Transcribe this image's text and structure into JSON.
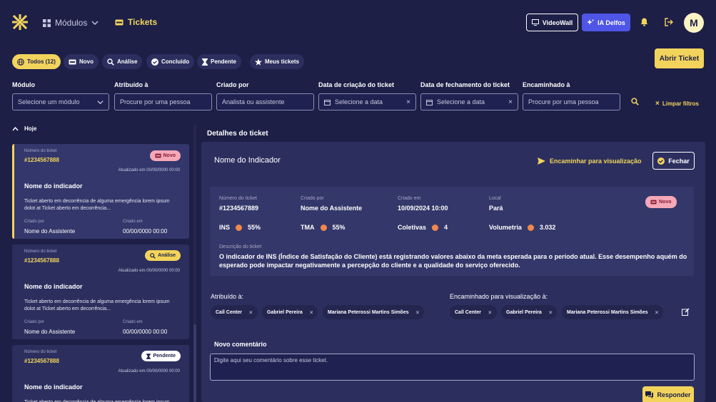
{
  "header": {
    "modulos_label": "Módulos",
    "tickets_label": "Tickets",
    "videowall_label": "VideoWall",
    "ia_label": "IA Delfos",
    "avatar_initial": "M"
  },
  "chips": [
    "Todos (12)",
    "Novo",
    "Análise",
    "Concluído",
    "Pendente",
    "Meus tickets"
  ],
  "abrir_ticket": "Abrir Ticket",
  "filters": {
    "modulo": {
      "label": "Módulo",
      "placeholder": "Selecione um módulo"
    },
    "atribuido": {
      "label": "Atribuído à",
      "placeholder": "Procure por uma pessoa"
    },
    "criado": {
      "label": "Criado por",
      "placeholder": "Analista ou assistente"
    },
    "data_criacao": {
      "label": "Data de criação do ticket",
      "placeholder": "Selecione a data"
    },
    "data_fechamento": {
      "label": "Data de fechamento do ticket",
      "placeholder": "Selecione a data"
    },
    "encaminhado": {
      "label": "Encaminhado à",
      "placeholder": "Procure por uma pessoa"
    },
    "limpar": "Limpar filtros"
  },
  "list": {
    "group_label": "Hoje",
    "tickets": [
      {
        "num_label": "Número do ticket",
        "num": "#1234567888",
        "status": "Novo",
        "updated": "Atualizado em 00/00/0000 00:00",
        "title": "Nome do indicador",
        "desc": "Ticket aberto em decorrência de alguma emergência lorem ipsum dolot at Ticket aberto em decorrência...",
        "cp_label": "Criado por",
        "cp": "Nome do Assistente",
        "ce_label": "Criado em",
        "ce": "00/00/0000 00:00"
      },
      {
        "num_label": "Número do ticket",
        "num": "#1234567888",
        "status": "Análise",
        "updated": "Atualizado em 00/00/0000 00:00",
        "title": "Nome do indicador",
        "desc": "Ticket aberto em decorrência de alguma emergência lorem ipsum dolot at Ticket aberto em decorrência...",
        "cp_label": "Criado por",
        "cp": "Nome do Assistente",
        "ce_label": "Criado em",
        "ce": "00/00/0000 00:00"
      },
      {
        "num_label": "Número do ticket",
        "num": "#1234567888",
        "status": "Pendente",
        "updated": "Atualizado em 00/00/0000 00:00",
        "title": "Nome do indicador",
        "desc": "Ticket aberto em decorrência de alguma emergência lorem ipsum dolot at Ticket aberto em decorrência...",
        "cp_label": "Criado por",
        "cp": "Nome do Assistente",
        "ce_label": "Criado em",
        "ce": "00/00/0000 00:00"
      }
    ]
  },
  "detail": {
    "section_title": "Detalhes do ticket",
    "indicator_name": "Nome do Indicador",
    "encaminhar_label": "Encaminhar para visualização",
    "fechar_label": "Fechar",
    "info": {
      "num_label": "Número do ticket",
      "num": "#1234567889",
      "criado_por_label": "Criado por",
      "criado_por": "Nome do Assistente",
      "criado_em_label": "Criado em",
      "criado_em": "10/09/2024 10:00",
      "local_label": "Local",
      "local": "Pará",
      "status": "Novo"
    },
    "metrics": [
      {
        "label": "INS",
        "value": "55%"
      },
      {
        "label": "TMA",
        "value": "55%"
      },
      {
        "label": "Coletivas",
        "value": "4"
      },
      {
        "label": "Volumetria",
        "value": "3.032"
      }
    ],
    "desc_label": "Descrição do ticket",
    "desc": "O indicador de INS (Índice de Satisfação do Cliente) está registrando valores abaixo da meta esperada para o período atual. Esse desempenho aquém do esperado pode impactar negativamente a percepção do cliente e a qualidade do serviço oferecido.",
    "atribuido_label": "Atribuído à:",
    "atribuido": [
      "Call Center",
      "Gabriel Pereira",
      "Mariana Peterossi Martins Simões"
    ],
    "encaminhado_label": "Encaminhado para visualização à:",
    "encaminhado": [
      "Call Center",
      "Gabriel Pereira",
      "Mariana Peterossi Martins Simões"
    ],
    "comentario_label": "Novo comentário",
    "comentario_placeholder": "Digite aqui seu comentário sobre esse ticket.",
    "responder_label": "Responder"
  },
  "colors": {
    "background": "#1d1f47",
    "panel": "#2c2f5e",
    "accent": "#f2d45c",
    "primary": "#4f55e6",
    "metric_dot": "#f2874c"
  }
}
